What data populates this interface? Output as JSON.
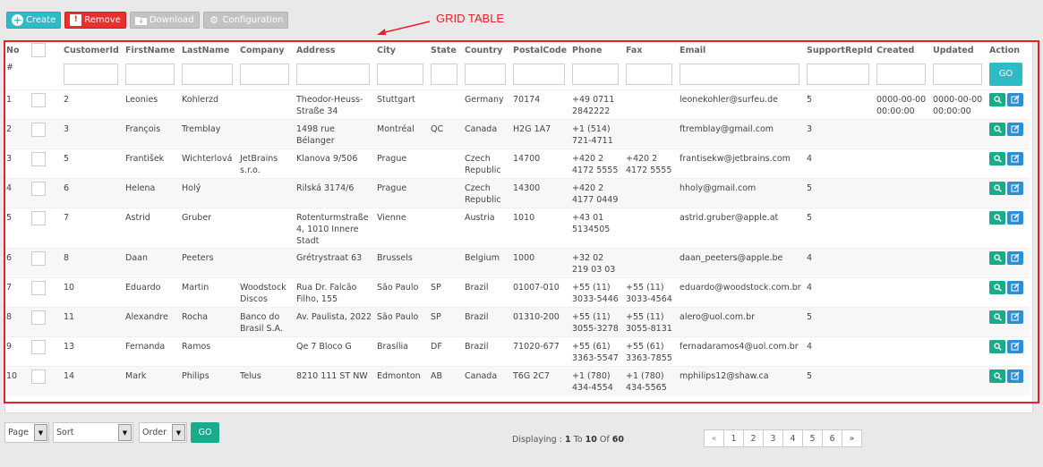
{
  "toolbar": {
    "create": "Create",
    "remove": "Remove",
    "download": "Download",
    "configuration": "Configuration"
  },
  "annotation": {
    "label": "GRID TABLE",
    "color": "#e8202a"
  },
  "grid": {
    "columns": [
      "No",
      "",
      "CustomerId",
      "FirstName",
      "LastName",
      "Company",
      "Address",
      "City",
      "State",
      "Country",
      "PostalCode",
      "Phone",
      "Fax",
      "Email",
      "SupportRepId",
      "Created",
      "Updated",
      "Action"
    ],
    "filter_row_label": "#",
    "go_label": "GO",
    "rows": [
      {
        "no": "1",
        "id": "2",
        "first": "Leonies",
        "last": "Kohlerzd",
        "company": "",
        "address": "Theodor-Heuss-Straße 34",
        "city": "Stuttgart",
        "state": "",
        "country": "Germany",
        "postal": "70174",
        "phone": "+49 0711 2842222",
        "fax": "",
        "email": "leonekohler@surfeu.de",
        "rep": "5",
        "created": "0000-00-00 00:00:00",
        "updated": "0000-00-00 00:00:00"
      },
      {
        "no": "2",
        "id": "3",
        "first": "François",
        "last": "Tremblay",
        "company": "",
        "address": "1498 rue Bélanger",
        "city": "Montréal",
        "state": "QC",
        "country": "Canada",
        "postal": "H2G 1A7",
        "phone": "+1 (514) 721-4711",
        "fax": "",
        "email": "ftremblay@gmail.com",
        "rep": "3",
        "created": "",
        "updated": ""
      },
      {
        "no": "3",
        "id": "5",
        "first": "František",
        "last": "Wichterlová",
        "company": "JetBrains s.r.o.",
        "address": "Klanova 9/506",
        "city": "Prague",
        "state": "",
        "country": "Czech Republic",
        "postal": "14700",
        "phone": "+420 2 4172 5555",
        "fax": "+420 2 4172 5555",
        "email": "frantisekw@jetbrains.com",
        "rep": "4",
        "created": "",
        "updated": ""
      },
      {
        "no": "4",
        "id": "6",
        "first": "Helena",
        "last": "Holý",
        "company": "",
        "address": "Rilská 3174/6",
        "city": "Prague",
        "state": "",
        "country": "Czech Republic",
        "postal": "14300",
        "phone": "+420 2 4177 0449",
        "fax": "",
        "email": "hholy@gmail.com",
        "rep": "5",
        "created": "",
        "updated": ""
      },
      {
        "no": "5",
        "id": "7",
        "first": "Astrid",
        "last": "Gruber",
        "company": "",
        "address": "Rotenturmstraße 4, 1010 Innere Stadt",
        "city": "Vienne",
        "state": "",
        "country": "Austria",
        "postal": "1010",
        "phone": "+43 01 5134505",
        "fax": "",
        "email": "astrid.gruber@apple.at",
        "rep": "5",
        "created": "",
        "updated": ""
      },
      {
        "no": "6",
        "id": "8",
        "first": "Daan",
        "last": "Peeters",
        "company": "",
        "address": "Grétrystraat 63",
        "city": "Brussels",
        "state": "",
        "country": "Belgium",
        "postal": "1000",
        "phone": "+32 02 219 03 03",
        "fax": "",
        "email": "daan_peeters@apple.be",
        "rep": "4",
        "created": "",
        "updated": ""
      },
      {
        "no": "7",
        "id": "10",
        "first": "Eduardo",
        "last": "Martin",
        "company": "Woodstock Discos",
        "address": "Rua Dr. Falcão Filho, 155",
        "city": "São Paulo",
        "state": "SP",
        "country": "Brazil",
        "postal": "01007-010",
        "phone": "+55 (11) 3033-5446",
        "fax": "+55 (11) 3033-4564",
        "email": "eduardo@woodstock.com.br",
        "rep": "4",
        "created": "",
        "updated": ""
      },
      {
        "no": "8",
        "id": "11",
        "first": "Alexandre",
        "last": "Rocha",
        "company": "Banco do Brasil S.A.",
        "address": "Av. Paulista, 2022",
        "city": "São Paulo",
        "state": "SP",
        "country": "Brazil",
        "postal": "01310-200",
        "phone": "+55 (11) 3055-3278",
        "fax": "+55 (11) 3055-8131",
        "email": "alero@uol.com.br",
        "rep": "5",
        "created": "",
        "updated": ""
      },
      {
        "no": "9",
        "id": "13",
        "first": "Fernanda",
        "last": "Ramos",
        "company": "",
        "address": "Qe 7 Bloco G",
        "city": "Brasília",
        "state": "DF",
        "country": "Brazil",
        "postal": "71020-677",
        "phone": "+55 (61) 3363-5547",
        "fax": "+55 (61) 3363-7855",
        "email": "fernadaramos4@uol.com.br",
        "rep": "4",
        "created": "",
        "updated": ""
      },
      {
        "no": "10",
        "id": "14",
        "first": "Mark",
        "last": "Philips",
        "company": "Telus",
        "address": "8210 111 ST NW",
        "city": "Edmonton",
        "state": "AB",
        "country": "Canada",
        "postal": "T6G 2C7",
        "phone": "+1 (780) 434-4554",
        "fax": "+1 (780) 434-5565",
        "email": "mphilips12@shaw.ca",
        "rep": "5",
        "created": "",
        "updated": ""
      }
    ]
  },
  "footer": {
    "page_select": "Page",
    "sort_select": "Sort",
    "order_select": "Order",
    "go_label": "GO",
    "display_prefix": "Displaying : ",
    "display_from": "1",
    "display_to_word": " To ",
    "display_to": "10",
    "display_of_word": " Of ",
    "display_total": "60",
    "pager": [
      "«",
      "1",
      "2",
      "3",
      "4",
      "5",
      "6",
      "»"
    ]
  },
  "colors": {
    "accent": "#2dbbc6",
    "danger": "#e8312f",
    "view": "#1aab8a",
    "edit": "#2c8fd6"
  }
}
